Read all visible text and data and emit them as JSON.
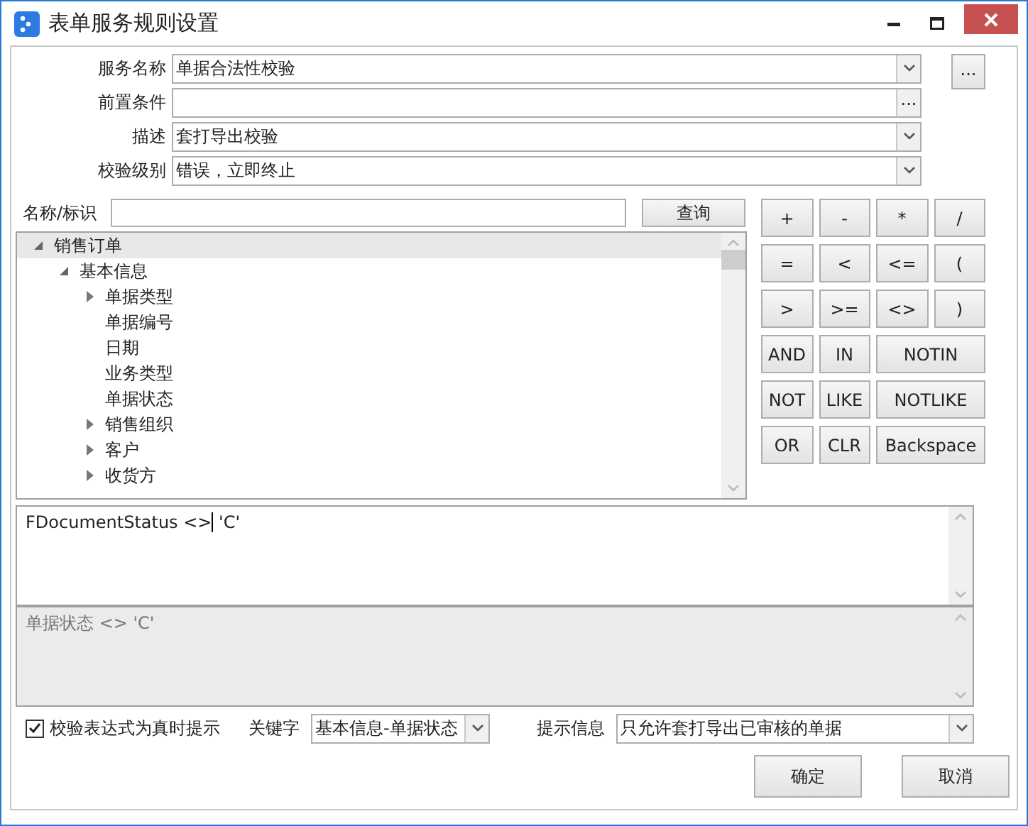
{
  "window": {
    "title": "表单服务规则设置"
  },
  "fields": [
    {
      "label": "服务名称",
      "value": "单据合法性校验",
      "kind": "dropdown"
    },
    {
      "label": "前置条件",
      "button": "...",
      "kind": "ellipsis"
    },
    {
      "label": "描述",
      "value": "套打导出校验",
      "kind": "dropdown"
    },
    {
      "label": "校验级别",
      "value": "错误，立即终止",
      "kind": "dropdown"
    }
  ],
  "more_button": "...",
  "search": {
    "label": "名称/标识",
    "button": "查询"
  },
  "tree": [
    {
      "label": "销售订单",
      "kind": "group",
      "expanded": true,
      "selected": true,
      "children": [
        {
          "label": "基本信息",
          "kind": "group",
          "expanded": true,
          "selected": false,
          "children": [
            {
              "label": "单据类型",
              "kind": "group",
              "expanded": false,
              "selected": false
            },
            {
              "label": "单据编号",
              "kind": "leaf",
              "expanded": false,
              "selected": false
            },
            {
              "label": "日期",
              "kind": "leaf",
              "expanded": false,
              "selected": false
            },
            {
              "label": "业务类型",
              "kind": "leaf",
              "expanded": false,
              "selected": false
            },
            {
              "label": "单据状态",
              "kind": "leaf",
              "expanded": false,
              "selected": false
            },
            {
              "label": "销售组织",
              "kind": "group",
              "expanded": false,
              "selected": false
            },
            {
              "label": "客户",
              "kind": "group",
              "expanded": false,
              "selected": false
            },
            {
              "label": "收货方",
              "kind": "group",
              "expanded": false,
              "selected": false
            }
          ]
        }
      ]
    }
  ],
  "operators": [
    {
      "label": "+",
      "wide": false
    },
    {
      "label": "-",
      "wide": false
    },
    {
      "label": "*",
      "wide": false
    },
    {
      "label": "/",
      "wide": false
    },
    {
      "label": "=",
      "wide": false
    },
    {
      "label": "<",
      "wide": false
    },
    {
      "label": "<=",
      "wide": false
    },
    {
      "label": "(",
      "wide": false
    },
    {
      "label": ">",
      "wide": false
    },
    {
      "label": ">=",
      "wide": false
    },
    {
      "label": "<>",
      "wide": false
    },
    {
      "label": ")",
      "wide": false
    },
    {
      "label": "AND",
      "wide": false
    },
    {
      "label": "IN",
      "wide": false
    },
    {
      "label": "NOTIN",
      "wide": true
    },
    {
      "label": "NOT",
      "wide": false
    },
    {
      "label": "LIKE",
      "wide": false
    },
    {
      "label": "NOTLIKE",
      "wide": true
    },
    {
      "label": "OR",
      "wide": false
    },
    {
      "label": "CLR",
      "wide": false
    },
    {
      "label": "Backspace",
      "wide": true
    }
  ],
  "expression": {
    "before_cursor": "FDocumentStatus <>",
    "after_cursor": " 'C'"
  },
  "description": "单据状态 <> 'C'",
  "realtime_check": {
    "label": "校验表达式为真时提示",
    "checked": true
  },
  "keyword": {
    "label": "关键字",
    "value": "基本信息-单据状态"
  },
  "hint": {
    "label": "提示信息",
    "value": "只允许套打导出已审核的单据"
  },
  "buttons": [
    "确定",
    "取消"
  ]
}
